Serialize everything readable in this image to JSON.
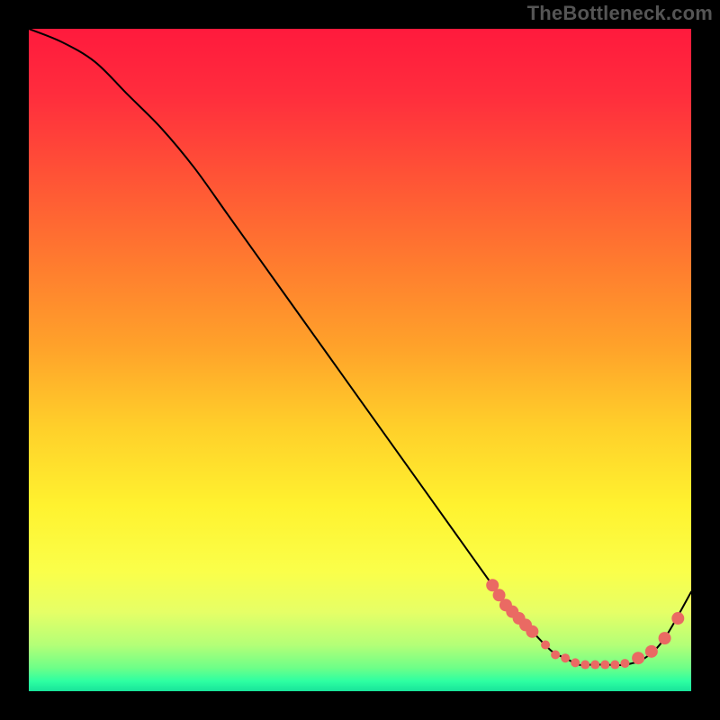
{
  "watermark": "TheBottleneck.com",
  "chart_data": {
    "type": "line",
    "title": "",
    "xlabel": "",
    "ylabel": "",
    "xlim": [
      0,
      100
    ],
    "ylim": [
      0,
      100
    ],
    "grid": false,
    "series": [
      {
        "name": "curve",
        "x": [
          0,
          5,
          10,
          15,
          20,
          25,
          30,
          35,
          40,
          45,
          50,
          55,
          60,
          65,
          70,
          73,
          76,
          79,
          81,
          83,
          85,
          87,
          90,
          93,
          96,
          100
        ],
        "y": [
          100,
          98,
          95,
          90,
          85,
          79,
          72,
          65,
          58,
          51,
          44,
          37,
          30,
          23,
          16,
          12,
          9,
          6,
          5,
          4,
          4,
          4,
          4,
          5,
          8,
          15
        ],
        "color": "#000000",
        "width": 2
      }
    ],
    "markers": {
      "name": "bottleneck-points",
      "color": "#ea6a63",
      "radius_small": 5,
      "radius_large": 7,
      "points": [
        {
          "x": 70.0,
          "y": 16.0,
          "r": "l"
        },
        {
          "x": 71.0,
          "y": 14.5,
          "r": "l"
        },
        {
          "x": 72.0,
          "y": 13.0,
          "r": "l"
        },
        {
          "x": 73.0,
          "y": 12.0,
          "r": "l"
        },
        {
          "x": 74.0,
          "y": 11.0,
          "r": "l"
        },
        {
          "x": 75.0,
          "y": 10.0,
          "r": "l"
        },
        {
          "x": 76.0,
          "y": 9.0,
          "r": "l"
        },
        {
          "x": 78.0,
          "y": 7.0,
          "r": "s"
        },
        {
          "x": 79.5,
          "y": 5.5,
          "r": "s"
        },
        {
          "x": 81.0,
          "y": 5.0,
          "r": "s"
        },
        {
          "x": 82.5,
          "y": 4.3,
          "r": "s"
        },
        {
          "x": 84.0,
          "y": 4.0,
          "r": "s"
        },
        {
          "x": 85.5,
          "y": 4.0,
          "r": "s"
        },
        {
          "x": 87.0,
          "y": 4.0,
          "r": "s"
        },
        {
          "x": 88.5,
          "y": 4.0,
          "r": "s"
        },
        {
          "x": 90.0,
          "y": 4.2,
          "r": "s"
        },
        {
          "x": 92.0,
          "y": 5.0,
          "r": "l"
        },
        {
          "x": 94.0,
          "y": 6.0,
          "r": "l"
        },
        {
          "x": 96.0,
          "y": 8.0,
          "r": "l"
        },
        {
          "x": 98.0,
          "y": 11.0,
          "r": "l"
        }
      ]
    },
    "background_gradient": {
      "stops": [
        {
          "offset": 0.0,
          "color": "#ff1a3d"
        },
        {
          "offset": 0.1,
          "color": "#ff2d3d"
        },
        {
          "offset": 0.22,
          "color": "#ff5236"
        },
        {
          "offset": 0.35,
          "color": "#ff7a2f"
        },
        {
          "offset": 0.48,
          "color": "#ffa22a"
        },
        {
          "offset": 0.6,
          "color": "#ffcf2a"
        },
        {
          "offset": 0.72,
          "color": "#fff22f"
        },
        {
          "offset": 0.82,
          "color": "#faff4a"
        },
        {
          "offset": 0.88,
          "color": "#e6ff66"
        },
        {
          "offset": 0.93,
          "color": "#b4ff77"
        },
        {
          "offset": 0.965,
          "color": "#6dff88"
        },
        {
          "offset": 0.985,
          "color": "#2dffa2"
        },
        {
          "offset": 1.0,
          "color": "#18e39a"
        }
      ]
    }
  }
}
